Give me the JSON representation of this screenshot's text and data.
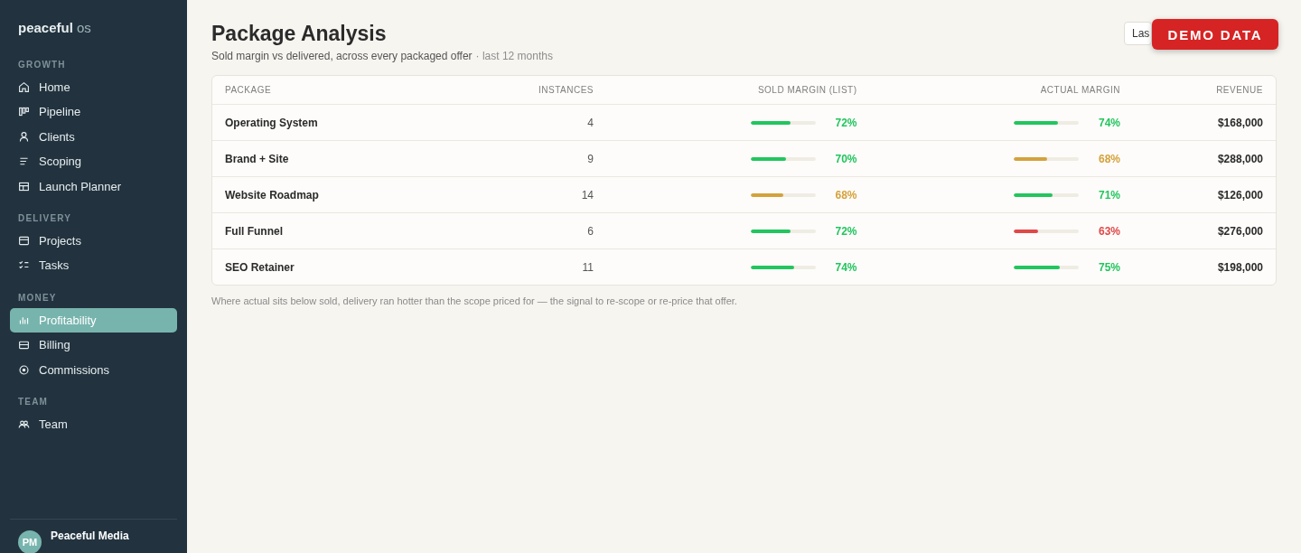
{
  "sidebar": {
    "brand": {
      "name": "peaceful",
      "suffix": "os"
    },
    "sections": [
      {
        "title": "GROWTH",
        "items": [
          {
            "label": "Home",
            "selected": false
          },
          {
            "label": "Pipeline",
            "selected": false
          },
          {
            "label": "Clients",
            "selected": false
          },
          {
            "label": "Scoping",
            "selected": false
          },
          {
            "label": "Launch Planner",
            "selected": false
          }
        ]
      },
      {
        "title": "DELIVERY",
        "items": [
          {
            "label": "Projects",
            "selected": false
          },
          {
            "label": "Tasks",
            "selected": false
          }
        ]
      },
      {
        "title": "MONEY",
        "items": [
          {
            "label": "Profitability",
            "selected": true
          },
          {
            "label": "Billing",
            "selected": false
          },
          {
            "label": "Commissions",
            "selected": false
          }
        ]
      },
      {
        "title": "TEAM",
        "items": [
          {
            "label": "Team",
            "selected": false
          }
        ]
      }
    ],
    "account": {
      "initials": "PM",
      "name": "Peaceful Media"
    }
  },
  "header": {
    "title": "Package Analysis",
    "subtitle": "Sold margin vs delivered, across every packaged offer",
    "period": "· last 12 months",
    "range_button": "Las",
    "badge": "DEMO DATA"
  },
  "table": {
    "columns": [
      "PACKAGE",
      "INSTANCES",
      "SOLD MARGIN (LIST)",
      "ACTUAL MARGIN",
      "REVENUE"
    ],
    "rows": [
      {
        "package": "Operating System",
        "instances": "4",
        "sold": {
          "level": 0.62,
          "reading": "72%",
          "color": "#22c55e"
        },
        "actual": {
          "level": 0.68,
          "reading": "74%",
          "color": "#22c55e"
        },
        "revenue": "$168,000"
      },
      {
        "package": "Brand + Site",
        "instances": "9",
        "sold": {
          "level": 0.55,
          "reading": "70%",
          "color": "#22c55e"
        },
        "actual": {
          "level": 0.51,
          "reading": "68%",
          "color": "#d4a23c"
        },
        "revenue": "$288,000"
      },
      {
        "package": "Website Roadmap",
        "instances": "14",
        "sold": {
          "level": 0.51,
          "reading": "68%",
          "color": "#d4a23c"
        },
        "actual": {
          "level": 0.6,
          "reading": "71%",
          "color": "#22c55e"
        },
        "revenue": "$126,000"
      },
      {
        "package": "Full Funnel",
        "instances": "6",
        "sold": {
          "level": 0.62,
          "reading": "72%",
          "color": "#22c55e"
        },
        "actual": {
          "level": 0.37,
          "reading": "63%",
          "color": "#e04848"
        },
        "revenue": "$276,000"
      },
      {
        "package": "SEO Retainer",
        "instances": "11",
        "sold": {
          "level": 0.68,
          "reading": "74%",
          "color": "#22c55e"
        },
        "actual": {
          "level": 0.71,
          "reading": "75%",
          "color": "#22c55e"
        },
        "revenue": "$198,000"
      }
    ]
  },
  "footnote": "Where actual sits below sold, delivery ran hotter than the scope priced for — the signal to re-scope or re-price that offer."
}
